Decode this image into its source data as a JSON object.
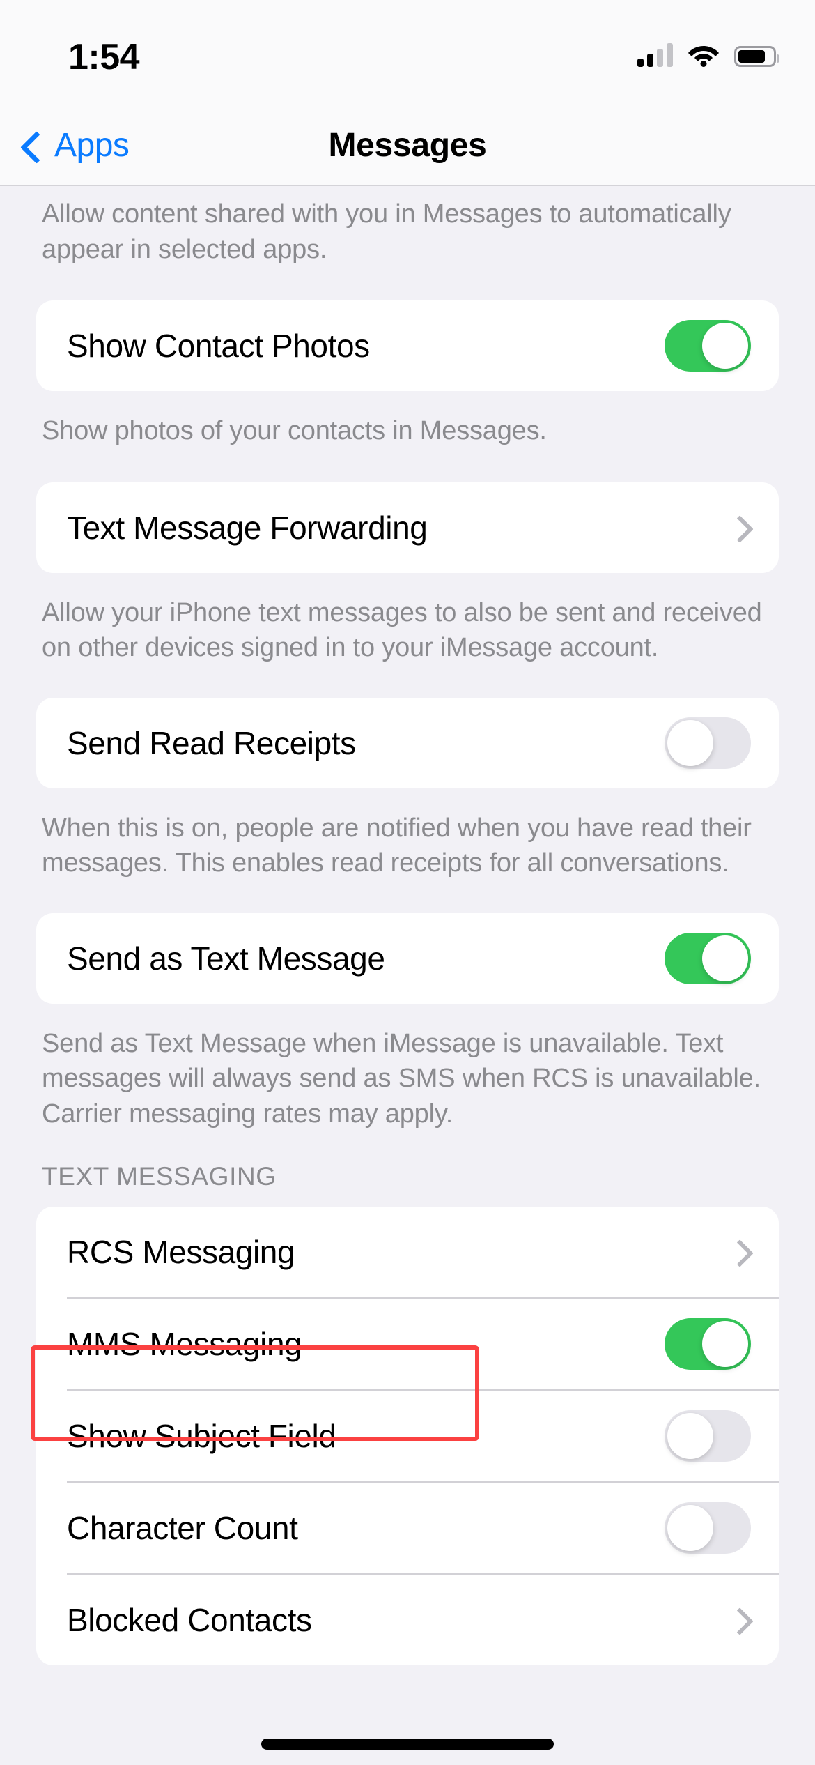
{
  "status_bar": {
    "time": "1:54",
    "cellular_icon": "cellular-signal-icon",
    "cellular_bars_filled": 2,
    "cellular_bars_total": 4,
    "wifi_icon": "wifi-icon",
    "battery_icon": "battery-icon",
    "battery_level_percent": 80
  },
  "nav_bar": {
    "back_label": "Apps",
    "back_icon": "chevron-left-icon",
    "title": "Messages"
  },
  "colors": {
    "accent_blue": "#0a7bff",
    "toggle_on_green": "#34c759",
    "toggle_off_gray": "#e6e5eb",
    "highlight_red": "#fb4141",
    "page_background": "#f2f1f6",
    "card_background": "#ffffff",
    "secondary_text": "#8a8a8e"
  },
  "content": {
    "footnote_top": "Allow content shared with you in Messages to automatically appear in selected apps.",
    "show_contact_photos": {
      "label": "Show Contact Photos",
      "toggle_state": "on",
      "footnote": "Show photos of your contacts in Messages."
    },
    "text_message_forwarding": {
      "label": "Text Message Forwarding",
      "accessory": "chevron-right-icon",
      "footnote": "Allow your iPhone text messages to also be sent and received on other devices signed in to your iMessage account."
    },
    "send_read_receipts": {
      "label": "Send Read Receipts",
      "toggle_state": "off",
      "footnote": "When this is on, people are notified when you have read their messages. This enables read receipts for all conversations."
    },
    "send_as_text_message": {
      "label": "Send as Text Message",
      "toggle_state": "on",
      "footnote": "Send as Text Message when iMessage is unavailable. Text messages will always send as SMS when RCS is unavailable. Carrier messaging rates may apply."
    },
    "text_messaging_section": {
      "header": "TEXT MESSAGING",
      "rows": [
        {
          "label": "RCS Messaging",
          "accessory": "chevron-right-icon",
          "highlighted": true
        },
        {
          "label": "MMS Messaging",
          "accessory": "toggle",
          "toggle_state": "on",
          "highlighted": false
        },
        {
          "label": "Show Subject Field",
          "accessory": "toggle",
          "toggle_state": "off",
          "highlighted": false
        },
        {
          "label": "Character Count",
          "accessory": "toggle",
          "toggle_state": "off",
          "highlighted": false
        },
        {
          "label": "Blocked Contacts",
          "accessory": "chevron-right-icon",
          "highlighted": false
        }
      ]
    }
  },
  "home_indicator": "home-indicator"
}
